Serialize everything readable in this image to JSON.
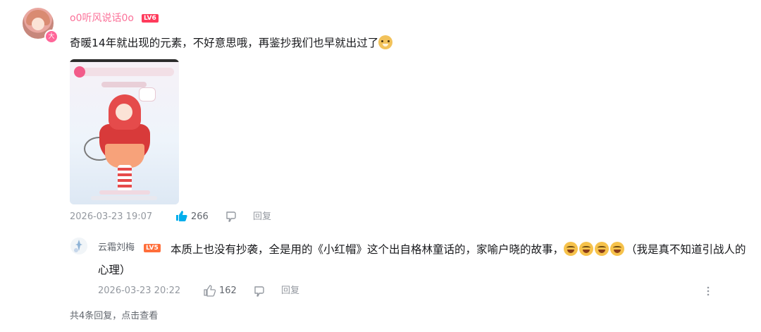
{
  "comment": {
    "username": "o0听风说话0o",
    "level": "LV6",
    "avatar_badge": "大",
    "text": "奇暖14年就出现的元素，不好意思哦，再鉴抄我们也早就出过了",
    "emoji": "doge-emoji",
    "timestamp": "2026-03-23 19:07",
    "likes": "266",
    "reply_label": "回复"
  },
  "reply": {
    "username": "云霜刘梅",
    "level": "LV5",
    "text_before": "本质上也没有抄袭，全是用的《小红帽》这个出自格林童话的，家喻户晓的故事，",
    "emoji_count": 4,
    "text_after": "（我是真不知道引战人的心理）",
    "timestamp": "2026-03-23 20:22",
    "likes": "162",
    "reply_label": "回复"
  },
  "footer": {
    "view_more": "共4条回复，点击查看"
  },
  "colors": {
    "username": "#fb7299",
    "meta": "#9499a0",
    "like_active": "#00aeec"
  }
}
